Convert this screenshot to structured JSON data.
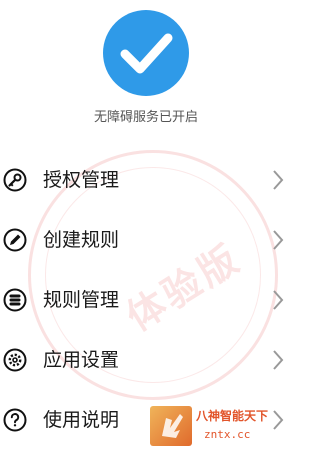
{
  "status": {
    "icon": "checkmark-icon",
    "text": "无障碍服务已开启",
    "color": "#2f9ae8"
  },
  "menu": {
    "items": [
      {
        "label": "授权管理",
        "icon": "key-icon"
      },
      {
        "label": "创建规则",
        "icon": "pencil-icon"
      },
      {
        "label": "规则管理",
        "icon": "database-icon"
      },
      {
        "label": "应用设置",
        "icon": "gear-icon"
      },
      {
        "label": "使用说明",
        "icon": "help-icon"
      }
    ]
  },
  "watermark": {
    "text": "体验版"
  },
  "corner_logo": {
    "line1": "八神智能天下",
    "line2": "zntx.cc"
  }
}
